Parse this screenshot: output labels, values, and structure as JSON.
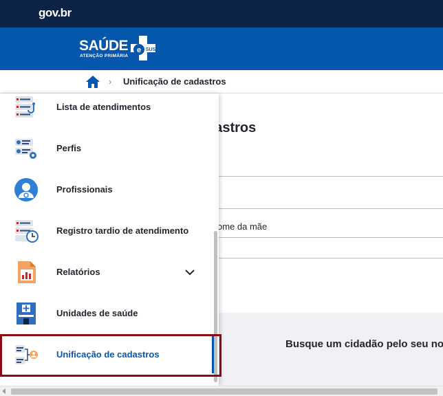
{
  "gov": {
    "logo": "gov.br"
  },
  "brand": {
    "name": "SAÚDE",
    "sub": "ATENÇÃO PRIMÁRIA",
    "badge": "e-SUS",
    "color": "#0556ad"
  },
  "breadcrumb": {
    "home_icon": "home-icon",
    "separator": "›",
    "current": "Unificação de cadastros"
  },
  "page": {
    "title": "Unificação de cadastros",
    "title_visible": "dastros",
    "field_label_visible": "ome da mãe"
  },
  "results": {
    "message": "Busque um cidadão pelo seu no"
  },
  "menu": {
    "items": [
      {
        "label": "Lista de atendimentos",
        "icon": "appointment-list-icon"
      },
      {
        "label": "Perfis",
        "icon": "profiles-icon"
      },
      {
        "label": "Profissionais",
        "icon": "professional-icon"
      },
      {
        "label": "Registro tardio de atendimento",
        "icon": "late-record-icon"
      },
      {
        "label": "Relatórios",
        "icon": "reports-icon",
        "has_submenu": true
      },
      {
        "label": "Unidades de saúde",
        "icon": "health-unit-icon"
      },
      {
        "label": "Unificação de cadastros",
        "icon": "merge-records-icon",
        "active": true
      }
    ]
  },
  "colors": {
    "gov_bar": "#0c2346",
    "brand_bar": "#0556ad",
    "highlight": "#8c0a16"
  }
}
